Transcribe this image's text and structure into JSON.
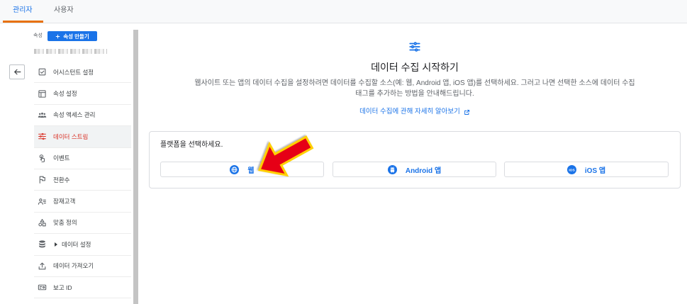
{
  "tabs": [
    {
      "label": "관리자",
      "selected": true
    },
    {
      "label": "사용자",
      "selected": false
    }
  ],
  "back_button": {
    "icon": "back-arrow-icon"
  },
  "sidebar": {
    "section_label": "속성",
    "create_button": {
      "icon": "plus-icon",
      "label": "속성 만들기"
    },
    "items": [
      {
        "label": "어시스턴트 설정",
        "icon": "assistant-checklist-icon"
      },
      {
        "label": "속성 설정",
        "icon": "window-icon"
      },
      {
        "label": "속성 액세스 관리",
        "icon": "group-icon"
      },
      {
        "label": "데이터 스트림",
        "icon": "data-stream-icon",
        "selected": true
      },
      {
        "label": "이벤트",
        "icon": "touch-icon"
      },
      {
        "label": "전환수",
        "icon": "flag-icon"
      },
      {
        "label": "잠재고객",
        "icon": "audience-icon"
      },
      {
        "label": "맞춤 정의",
        "icon": "shapes-icon"
      },
      {
        "label": "데이터 설정",
        "icon": "database-icon",
        "expandable": true,
        "expand_icon": "expand-arrow-icon"
      },
      {
        "label": "데이터 가져오기",
        "icon": "upload-icon"
      },
      {
        "label": "보고 ID",
        "icon": "id-badge-icon"
      }
    ]
  },
  "main": {
    "icon": "data-stream-icon",
    "title": "데이터 수집 시작하기",
    "description": [
      "웹사이트 또는 앱의 데이터 수집을 설정하려면 데이터를 수집할 소스(예: 웹, Android 앱, iOS 앱)를 선택하세요. 그러고 나면 선택한 소스에 데이터 수집",
      "태그를 추가하는 방법을 안내해드립니다."
    ],
    "learn_more": {
      "label": "데이터 수집에 관해 자세히 알아보기",
      "icon": "external-link-icon"
    },
    "platform_card": {
      "prompt": "플랫폼을 선택하세요.",
      "buttons": [
        {
          "label": "웹",
          "icon": "globe-icon"
        },
        {
          "label": "Android 앱",
          "icon": "android-icon"
        },
        {
          "label": "iOS 앱",
          "icon": "ios-icon",
          "icon_text": "iOS"
        }
      ]
    }
  },
  "annotation": {
    "icon": "red-arrow-icon"
  },
  "colors": {
    "accent": "#1a73e8",
    "tab_underline": "#e8710a",
    "selected_item": "#d93025",
    "arrow_fill": "#e60012",
    "arrow_outline": "#ffd000"
  }
}
